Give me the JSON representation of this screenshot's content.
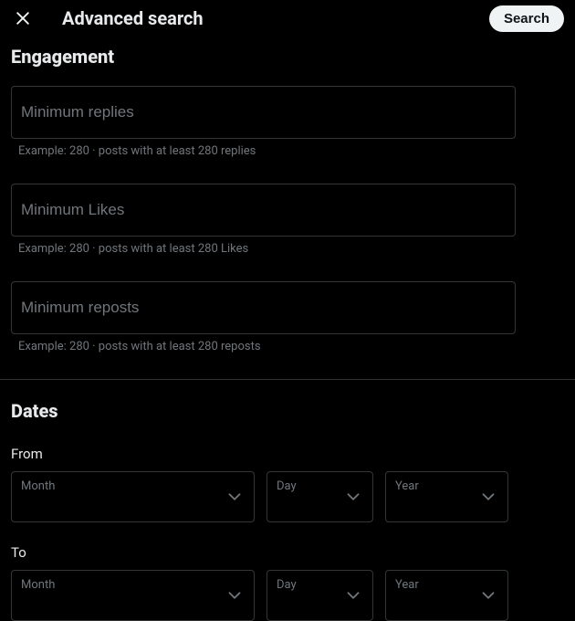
{
  "header": {
    "title": "Advanced search",
    "search_label": "Search"
  },
  "engagement": {
    "title": "Engagement",
    "fields": {
      "min_replies": {
        "label": "Minimum replies",
        "helper": "Example: 280 · posts with at least 280 replies"
      },
      "min_likes": {
        "label": "Minimum Likes",
        "helper": "Example: 280 · posts with at least 280 Likes"
      },
      "min_reposts": {
        "label": "Minimum reposts",
        "helper": "Example: 280 · posts with at least 280 reposts"
      }
    }
  },
  "dates": {
    "title": "Dates",
    "from_label": "From",
    "to_label": "To",
    "month_label": "Month",
    "day_label": "Day",
    "year_label": "Year"
  }
}
